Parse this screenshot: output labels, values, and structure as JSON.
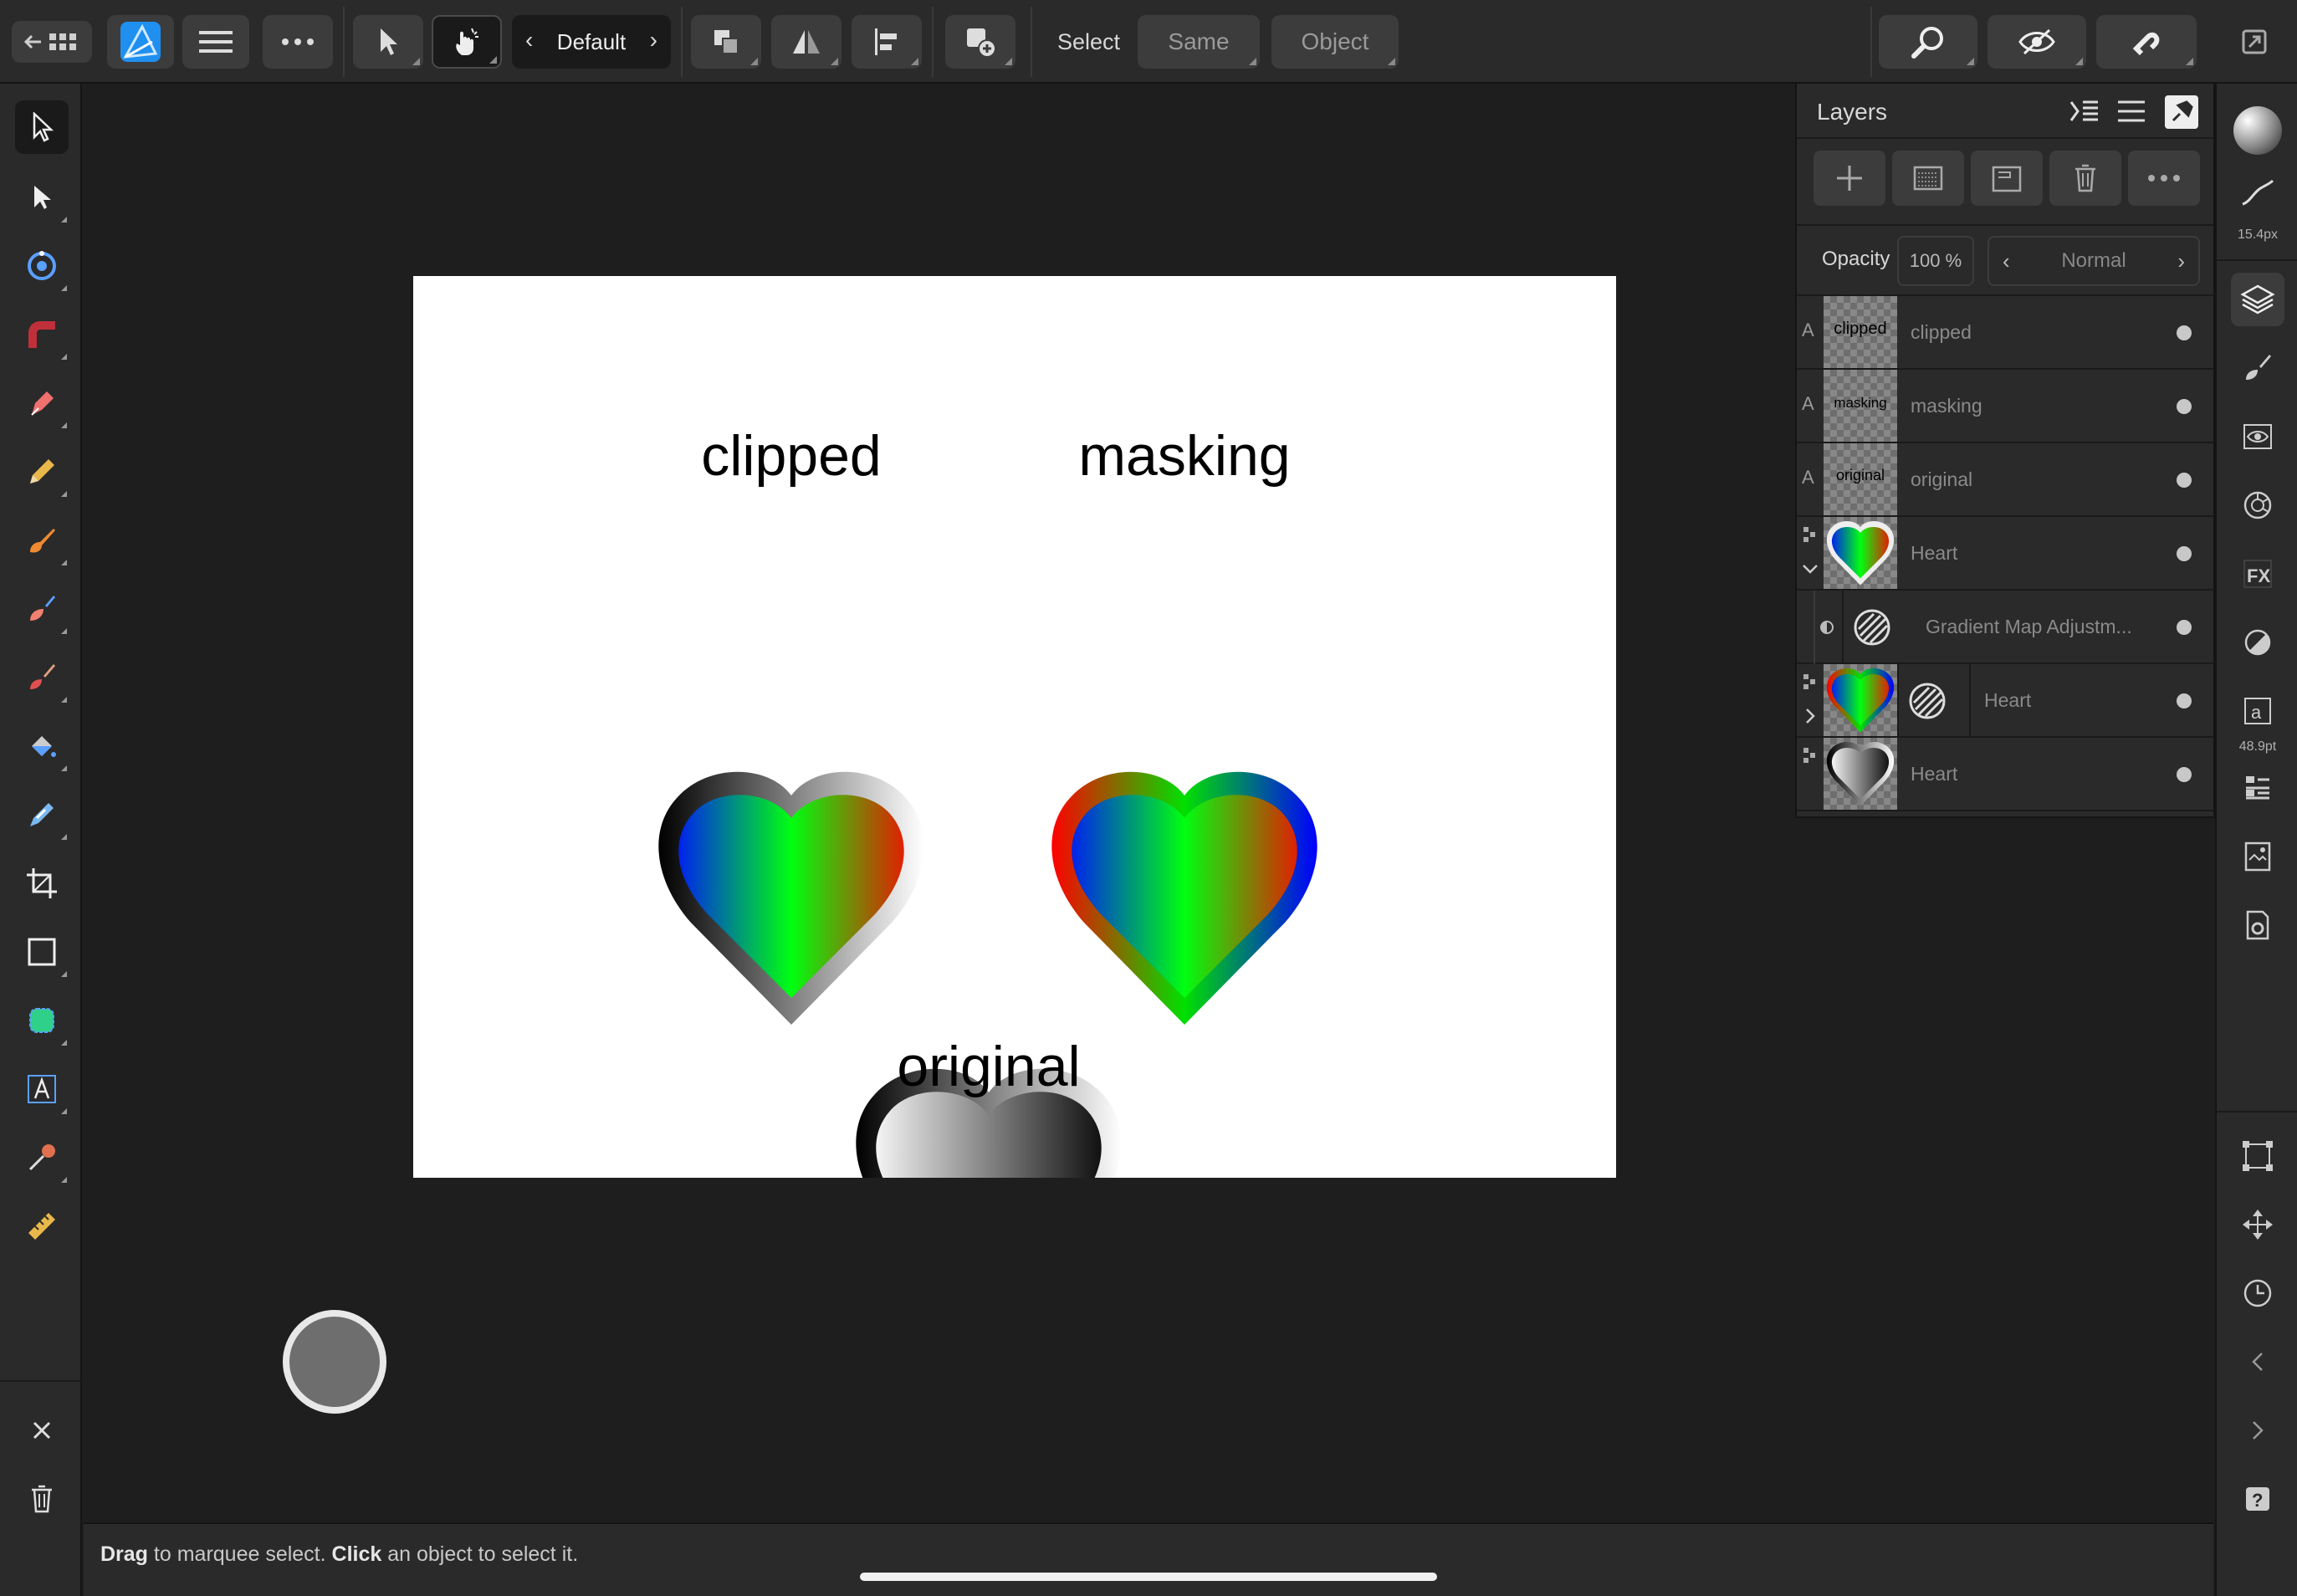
{
  "toolbar": {
    "persona_name": "Default",
    "select_label": "Select",
    "same_label": "Same",
    "object_label": "Object"
  },
  "document": {
    "labels": [
      "clipped",
      "masking",
      "original"
    ]
  },
  "layers_panel": {
    "title": "Layers",
    "opacity_label": "Opacity",
    "opacity_value": "100 %",
    "blend_mode": "Normal",
    "layers": [
      {
        "type_glyph": "A",
        "thumb_text": "clipped",
        "name": "clipped"
      },
      {
        "type_glyph": "A",
        "thumb_text": "masking",
        "name": "masking"
      },
      {
        "type_glyph": "A",
        "thumb_text": "original",
        "name": "original"
      },
      {
        "name": "Heart"
      },
      {
        "name": "Gradient Map Adjustm..."
      },
      {
        "name": "Heart"
      },
      {
        "name": "Heart"
      }
    ]
  },
  "right_toolbar": {
    "brush_size": "15.4px",
    "text_size": "48.9pt"
  },
  "status": {
    "part1_bold": "Drag",
    "part1": " to marquee select. ",
    "part2_bold": "Click",
    "part2": " an object to select it."
  },
  "colors": {
    "accent": "#1f8ff0",
    "bg": "#1e1e1e",
    "panel": "#2a2a2a"
  }
}
